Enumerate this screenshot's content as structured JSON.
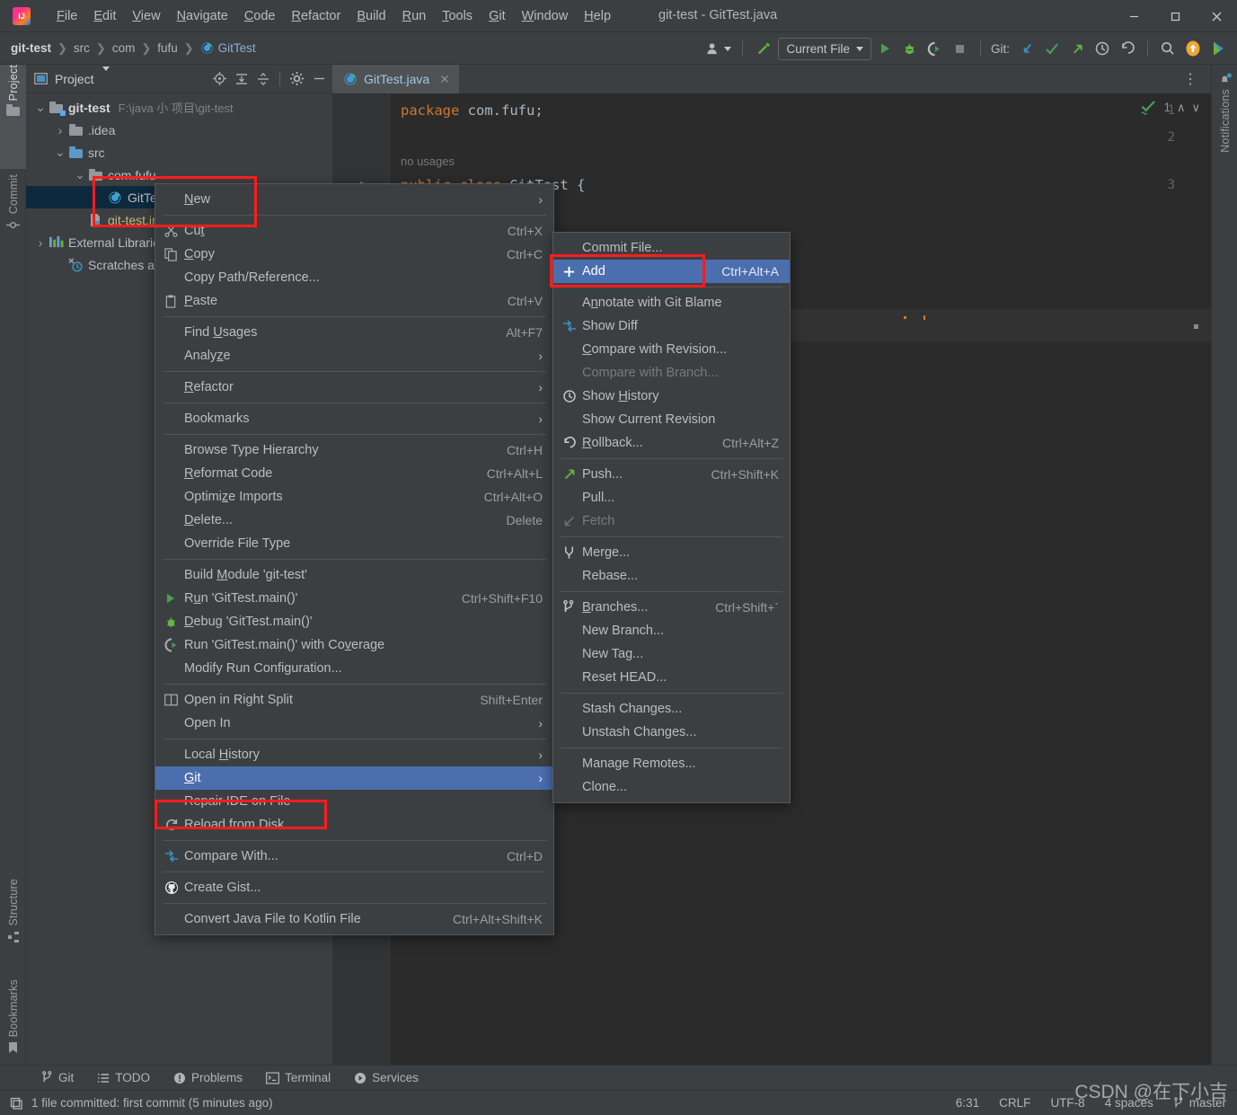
{
  "window": {
    "title": "git-test - GitTest.java",
    "minimize": "─",
    "maximize": "☐",
    "close": "✕"
  },
  "menubar": [
    {
      "label": "File",
      "mnemonic": "F"
    },
    {
      "label": "Edit",
      "mnemonic": "E"
    },
    {
      "label": "View",
      "mnemonic": "V"
    },
    {
      "label": "Navigate",
      "mnemonic": "N"
    },
    {
      "label": "Code",
      "mnemonic": "C"
    },
    {
      "label": "Refactor",
      "mnemonic": "R"
    },
    {
      "label": "Build",
      "mnemonic": "B"
    },
    {
      "label": "Run",
      "mnemonic": "R"
    },
    {
      "label": "Tools",
      "mnemonic": "T"
    },
    {
      "label": "Git",
      "mnemonic": "G"
    },
    {
      "label": "Window",
      "mnemonic": "W"
    },
    {
      "label": "Help",
      "mnemonic": "H"
    }
  ],
  "breadcrumbs": [
    {
      "label": "git-test"
    },
    {
      "label": "src"
    },
    {
      "label": "com"
    },
    {
      "label": "fufu"
    },
    {
      "label": "GitTest",
      "icon": "java-class-icon"
    }
  ],
  "toolbar": {
    "avatar_icon": "user-avatar-icon",
    "build_icon": "hammer-icon",
    "run_config": "Current File",
    "run_icon": "run-icon",
    "debug_icon": "debug-icon",
    "coverage_icon": "run-with-coverage-icon",
    "stop_icon": "stop-icon",
    "git_label": "Git:",
    "update_icon": "update-project-icon",
    "commit_icon": "commit-checkmark-icon",
    "push_icon": "push-arrow-icon",
    "history_icon": "history-clock-icon",
    "rollback_icon": "rollback-icon",
    "search_icon": "search-icon",
    "updates_icon": "ide-update-icon",
    "ai_icon": "ai-assistant-icon"
  },
  "left_strip": [
    {
      "label": "Project",
      "icon": "project-icon",
      "selected": true
    },
    {
      "label": "Commit",
      "icon": "commit-icon",
      "selected": false
    },
    {
      "label": "Structure",
      "icon": "structure-icon",
      "selected": false
    },
    {
      "label": "Bookmarks",
      "icon": "bookmark-icon",
      "selected": false
    }
  ],
  "right_strip": [
    {
      "label": "Notifications",
      "icon": "bell-icon"
    }
  ],
  "project_panel": {
    "title": "Project",
    "icon": "project-view-icon",
    "tools": [
      {
        "name": "select-opened-file-icon"
      },
      {
        "name": "expand-all-icon"
      },
      {
        "name": "collapse-all-icon"
      },
      {
        "name": "settings-gear-icon"
      },
      {
        "name": "hide-panel-icon"
      }
    ],
    "tree": [
      {
        "label": "git-test",
        "path": "F:\\java 小 项目\\git-test",
        "icon": "module-folder-icon",
        "twisty": "expanded",
        "depth": 0,
        "bold": true
      },
      {
        "label": ".idea",
        "icon": "folder-icon",
        "twisty": "collapsed",
        "depth": 1,
        "yellow": false
      },
      {
        "label": "src",
        "icon": "source-folder-icon",
        "twisty": "expanded",
        "depth": 1
      },
      {
        "label": "com.fufu",
        "icon": "package-icon",
        "twisty": "expanded",
        "depth": 2
      },
      {
        "label": "GitTest",
        "icon": "java-class-icon",
        "depth": 3,
        "selected": true
      },
      {
        "label": "git-test.iml",
        "icon": "iml-file-icon",
        "depth": 1,
        "yellow": true
      },
      {
        "label": "External Libraries",
        "icon": "libraries-icon",
        "twisty": "collapsed",
        "depth": 0
      },
      {
        "label": "Scratches and Consoles",
        "icon": "scratches-icon",
        "depth": 0
      }
    ]
  },
  "editor": {
    "tab": {
      "label": "GitTest.java",
      "icon": "java-class-icon",
      "close": "✕"
    },
    "kebab": "⋮",
    "inspection": {
      "icon": "inspections-ok-icon",
      "count": "1",
      "up": "∧",
      "down": "∨"
    },
    "lines": [
      {
        "num": "1",
        "tokens": [
          {
            "t": "package",
            "c": "kw"
          },
          {
            "t": " com.fufu;",
            "c": "id"
          }
        ]
      },
      {
        "num": "2",
        "tokens": []
      },
      {
        "num": "3",
        "run_marker": true,
        "hint": "no usages",
        "tokens": [
          {
            "t": "public class ",
            "c": "kw"
          },
          {
            "t": "GitTest {",
            "c": "cls"
          }
        ]
      }
    ]
  },
  "context_menu": {
    "items": [
      {
        "label": "New",
        "mnemonic": "N",
        "submenu": true,
        "icon": null
      },
      {
        "sep": true
      },
      {
        "label": "Cut",
        "mnemonic": "t",
        "shortcut": "Ctrl+X",
        "icon": "scissors-icon"
      },
      {
        "label": "Copy",
        "mnemonic": "C",
        "shortcut": "Ctrl+C",
        "icon": "copy-icon"
      },
      {
        "label": "Copy Path/Reference...",
        "icon": null
      },
      {
        "label": "Paste",
        "mnemonic": "P",
        "shortcut": "Ctrl+V",
        "icon": "paste-icon"
      },
      {
        "sep": true
      },
      {
        "label": "Find Usages",
        "mnemonic": "U",
        "shortcut": "Alt+F7"
      },
      {
        "label": "Analyze",
        "mnemonic": "z",
        "submenu": true
      },
      {
        "sep": true
      },
      {
        "label": "Refactor",
        "mnemonic": "R",
        "submenu": true
      },
      {
        "sep": true
      },
      {
        "label": "Bookmarks",
        "submenu": true
      },
      {
        "sep": true
      },
      {
        "label": "Browse Type Hierarchy",
        "shortcut": "Ctrl+H"
      },
      {
        "label": "Reformat Code",
        "mnemonic": "R",
        "shortcut": "Ctrl+Alt+L"
      },
      {
        "label": "Optimize Imports",
        "mnemonic": "z",
        "shortcut": "Ctrl+Alt+O"
      },
      {
        "label": "Delete...",
        "mnemonic": "D",
        "shortcut": "Delete"
      },
      {
        "label": "Override File Type"
      },
      {
        "sep": true
      },
      {
        "label": "Build Module 'git-test'",
        "mnemonic": "M"
      },
      {
        "label": "Run 'GitTest.main()'",
        "mnemonic": "u",
        "shortcut": "Ctrl+Shift+F10",
        "icon": "run-icon"
      },
      {
        "label": "Debug 'GitTest.main()'",
        "mnemonic": "D",
        "icon": "debug-icon"
      },
      {
        "label": "Run 'GitTest.main()' with Coverage",
        "mnemonic": "v",
        "icon": "run-with-coverage-icon"
      },
      {
        "label": "Modify Run Configuration..."
      },
      {
        "sep": true
      },
      {
        "label": "Open in Right Split",
        "shortcut": "Shift+Enter",
        "icon": "split-right-icon"
      },
      {
        "label": "Open In",
        "submenu": true
      },
      {
        "sep": true
      },
      {
        "label": "Local History",
        "mnemonic": "H",
        "submenu": true
      },
      {
        "label": "Git",
        "mnemonic": "G",
        "submenu": true,
        "highlighted": true
      },
      {
        "label": "Repair IDE on File"
      },
      {
        "label": "Reload from Disk",
        "icon": "reload-icon"
      },
      {
        "sep": true
      },
      {
        "label": "Compare With...",
        "shortcut": "Ctrl+D",
        "icon": "compare-icon"
      },
      {
        "sep": true
      },
      {
        "label": "Create Gist...",
        "icon": "github-icon"
      },
      {
        "sep": true
      },
      {
        "label": "Convert Java File to Kotlin File",
        "shortcut": "Ctrl+Alt+Shift+K"
      }
    ]
  },
  "git_submenu": {
    "items": [
      {
        "label": "Commit File...",
        "icon": null
      },
      {
        "label": "Add",
        "shortcut": "Ctrl+Alt+A",
        "icon": "plus-icon",
        "highlighted": true
      },
      {
        "sep": true
      },
      {
        "label": "Annotate with Git Blame",
        "mnemonic": "n"
      },
      {
        "label": "Show Diff",
        "icon": "compare-icon"
      },
      {
        "label": "Compare with Revision...",
        "mnemonic": "C"
      },
      {
        "label": "Compare with Branch...",
        "disabled": true
      },
      {
        "label": "Show History",
        "mnemonic": "H",
        "icon": "history-clock-icon"
      },
      {
        "label": "Show Current Revision"
      },
      {
        "label": "Rollback...",
        "mnemonic": "R",
        "shortcut": "Ctrl+Alt+Z",
        "icon": "rollback-icon"
      },
      {
        "sep": true
      },
      {
        "label": "Push...",
        "shortcut": "Ctrl+Shift+K",
        "icon": "push-arrow-icon"
      },
      {
        "label": "Pull..."
      },
      {
        "label": "Fetch",
        "disabled": true,
        "icon": "fetch-icon"
      },
      {
        "sep": true
      },
      {
        "label": "Merge...",
        "icon": "merge-icon"
      },
      {
        "label": "Rebase..."
      },
      {
        "sep": true
      },
      {
        "label": "Branches...",
        "mnemonic": "B",
        "shortcut": "Ctrl+Shift+`",
        "icon": "branch-icon"
      },
      {
        "label": "New Branch..."
      },
      {
        "label": "New Tag..."
      },
      {
        "label": "Reset HEAD..."
      },
      {
        "sep": true
      },
      {
        "label": "Stash Changes..."
      },
      {
        "label": "Unstash Changes..."
      },
      {
        "sep": true
      },
      {
        "label": "Manage Remotes..."
      },
      {
        "label": "Clone..."
      }
    ]
  },
  "tool_windows": [
    {
      "label": "Git",
      "icon": "branch-icon"
    },
    {
      "label": "TODO",
      "icon": "todo-list-icon"
    },
    {
      "label": "Problems",
      "icon": "problems-icon"
    },
    {
      "label": "Terminal",
      "icon": "terminal-icon"
    },
    {
      "label": "Services",
      "icon": "services-icon"
    }
  ],
  "status_bar": {
    "message": "1 file committed: first commit (5 minutes ago)",
    "message_icon": "event-log-icon",
    "caret_position": "6:31",
    "line_separator": "CRLF",
    "encoding": "UTF-8",
    "indent": "4 spaces",
    "branch": "master",
    "branch_icon": "branch-icon"
  },
  "watermark": "CSDN @在下小吉",
  "colors": {
    "panel_bg": "#3c3f41",
    "editor_bg": "#2b2b2b",
    "menu_highlight": "#4b6eaf",
    "tree_selection": "#0d293e",
    "annotation_red": "#fc1d1d",
    "green": "#499c54",
    "keyword_orange": "#cc7832",
    "identifier": "#a9b7c6"
  }
}
